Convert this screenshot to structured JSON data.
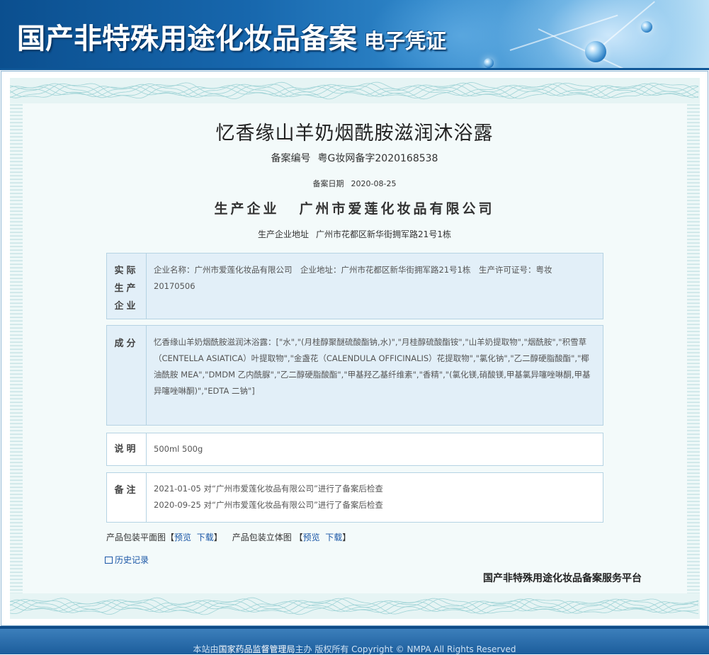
{
  "header": {
    "title": "国产非特殊用途化妆品备案",
    "subtitle": "电子凭证"
  },
  "product": {
    "name": "忆香缘山羊奶烟酰胺滋润沐浴露",
    "reg_no_label": "备案编号",
    "reg_no": "粤G妆网备字2020168538",
    "reg_date_label": "备案日期",
    "reg_date": "2020-08-25",
    "producer_label": "生产企业",
    "producer": "广州市爱莲化妆品有限公司",
    "producer_addr_label": "生产企业地址",
    "producer_addr": "广州市花都区新华街拥军路21号1栋"
  },
  "actual_producer": {
    "label_1": "实际",
    "label_2": "生产",
    "label_3": "企业",
    "text": "企业名称：广州市爱莲化妆品有限公司　企业地址：广州市花都区新华街拥军路21号1栋　生产许可证号：粤妆20170506"
  },
  "ingredients": {
    "label": "成分",
    "text": "忆香缘山羊奶烟酰胺滋润沐浴露：[\"水\",\"(月桂醇聚醚硫酸酯钠,水)\",\"月桂醇硫酸酯铵\",\"山羊奶提取物\",\"烟酰胺\",\"积雪草（CENTELLA ASIATICA）叶提取物\",\"金盏花（CALENDULA OFFICINALIS）花提取物\",\"氯化钠\",\"乙二醇硬脂酸酯\",\"椰油酰胺 MEA\",\"DMDM 乙内酰脲\",\"乙二醇硬脂酸酯\",\"甲基羟乙基纤维素\",\"香精\",\"(氯化镁,硝酸镁,甲基氯异噻唑啉酮,甲基异噻唑啉酮)\",\"EDTA 二钠\"]"
  },
  "notes": {
    "label": "说明",
    "text": "500ml 500g"
  },
  "remarks": {
    "label": "备注",
    "line_1": "2021-01-05 对“广州市爱莲化妆品有限公司”进行了备案后检查",
    "line_2": "2020-09-25 对“广州市爱莲化妆品有限公司”进行了备案后检查"
  },
  "downloads": {
    "flat_label": "产品包装平面图",
    "solid_label": "产品包装立体图",
    "bracket_open": "【",
    "bracket_close": "】",
    "preview": "预览",
    "download": "下载"
  },
  "history": {
    "label": "历史记录"
  },
  "platform": {
    "name": "国产非特殊用途化妆品备案服务平台"
  },
  "footer": {
    "prefix": "本站由",
    "agency": "国家药品监督管理局",
    "suffix": "主办 版权所有 Copyright © NMPA All Rights Reserved"
  },
  "colors": {
    "header_blue": "#1767ad",
    "box_blue": "#e2eff8",
    "link_blue": "#1a56a6",
    "footer_blue": "#1c5d9c"
  }
}
